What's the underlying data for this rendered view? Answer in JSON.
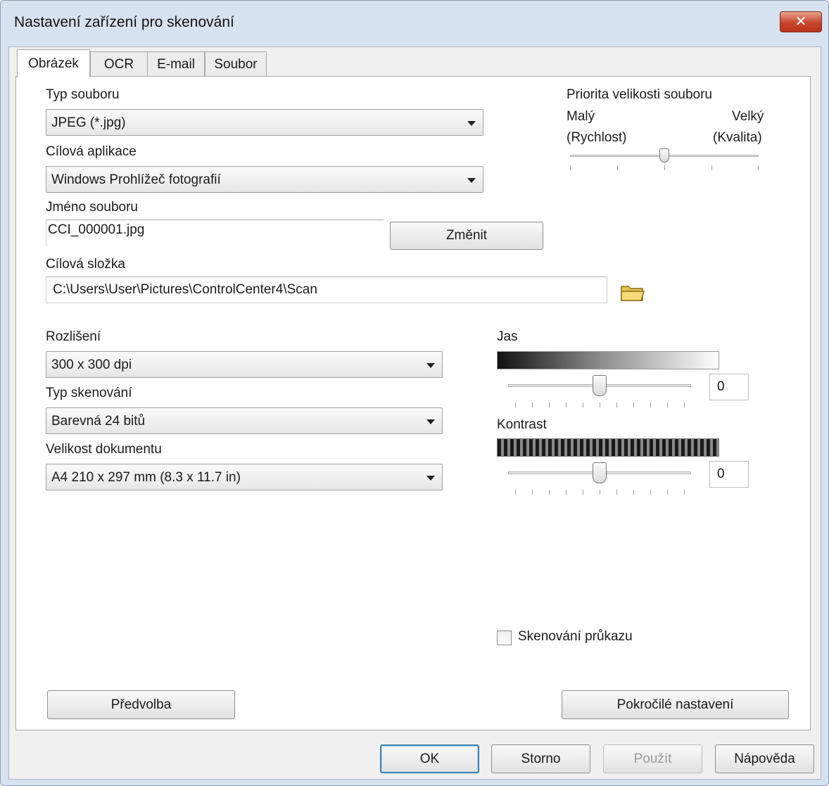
{
  "window": {
    "title": "Nastavení zařízení pro skenování"
  },
  "tabs": [
    {
      "label": "Obrázek",
      "active": true
    },
    {
      "label": "OCR",
      "active": false
    },
    {
      "label": "E-mail",
      "active": false
    },
    {
      "label": "Soubor",
      "active": false
    }
  ],
  "file_type": {
    "label": "Typ souboru",
    "value": "JPEG (*.jpg)"
  },
  "target_app": {
    "label": "Cílová aplikace",
    "value": "Windows Prohlížeč fotografií"
  },
  "file_name": {
    "label": "Jméno souboru",
    "value": "CCI_000001.jpg",
    "change_button": "Změnit"
  },
  "target_folder": {
    "label": "Cílová složka",
    "value": "C:\\Users\\User\\Pictures\\ControlCenter4\\Scan"
  },
  "size_priority": {
    "label": "Priorita velikosti souboru",
    "left_label": "Malý",
    "left_sub": "(Rychlost)",
    "right_label": "Velký",
    "right_sub": "(Kvalita)",
    "level": 0.5
  },
  "resolution": {
    "label": "Rozlišení",
    "value": "300 x 300 dpi"
  },
  "scan_type": {
    "label": "Typ skenování",
    "value": "Barevná 24 bitů"
  },
  "document_size": {
    "label": "Velikost dokumentu",
    "value": "A4 210 x 297 mm (8.3 x 11.7 in)"
  },
  "brightness": {
    "label": "Jas",
    "value": "0",
    "level": 0.5
  },
  "contrast": {
    "label": "Kontrast",
    "value": "0",
    "level": 0.5
  },
  "id_card_scan": {
    "label": "Skenování průkazu",
    "checked": false
  },
  "buttons": {
    "preset": "Předvolba",
    "advanced": "Pokročilé nastavení",
    "ok": "OK",
    "cancel": "Storno",
    "apply": "Použít",
    "help": "Nápověda"
  },
  "colors": {
    "close_button": "#c7452c",
    "window_frame": "#d6e2ef",
    "default_button_border": "#3c7fb1"
  },
  "icons": {
    "close": "close-icon",
    "folder": "folder-icon"
  }
}
